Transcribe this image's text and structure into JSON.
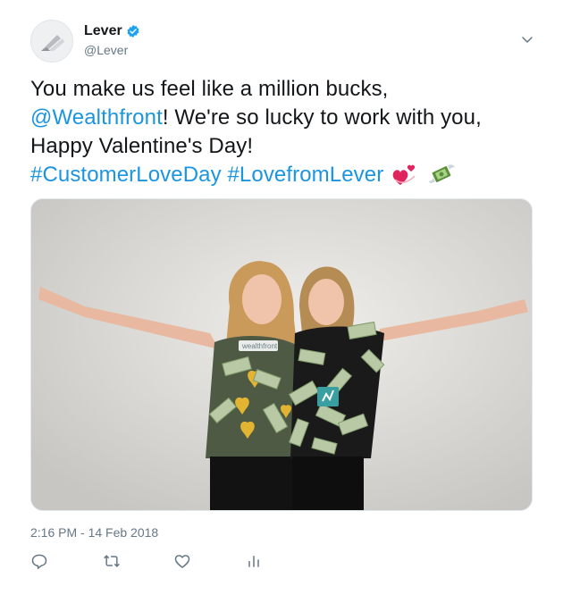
{
  "user": {
    "display_name": "Lever",
    "handle": "@Lever",
    "verified": true
  },
  "tweet": {
    "text_part1": "You make us feel like a million bucks, ",
    "mention": "@Wealthfront",
    "text_part2": "! We're so lucky to work with you, Happy Valentine's Day!",
    "hashtags": [
      "#CustomerLoveDay",
      "#LovefromLever"
    ],
    "emojis": [
      "revolving-hearts",
      "money-with-wings"
    ],
    "timestamp": "2:16 PM - 14 Feb 2018"
  },
  "photo": {
    "shirt_logo_text": "wealthfront"
  },
  "actions": [
    "reply-icon",
    "retweet-icon",
    "like-icon",
    "analytics-icon"
  ],
  "colors": {
    "link": "#1b95e0",
    "verified": "#1da1f2",
    "text": "#14171a",
    "muted": "#657786"
  }
}
